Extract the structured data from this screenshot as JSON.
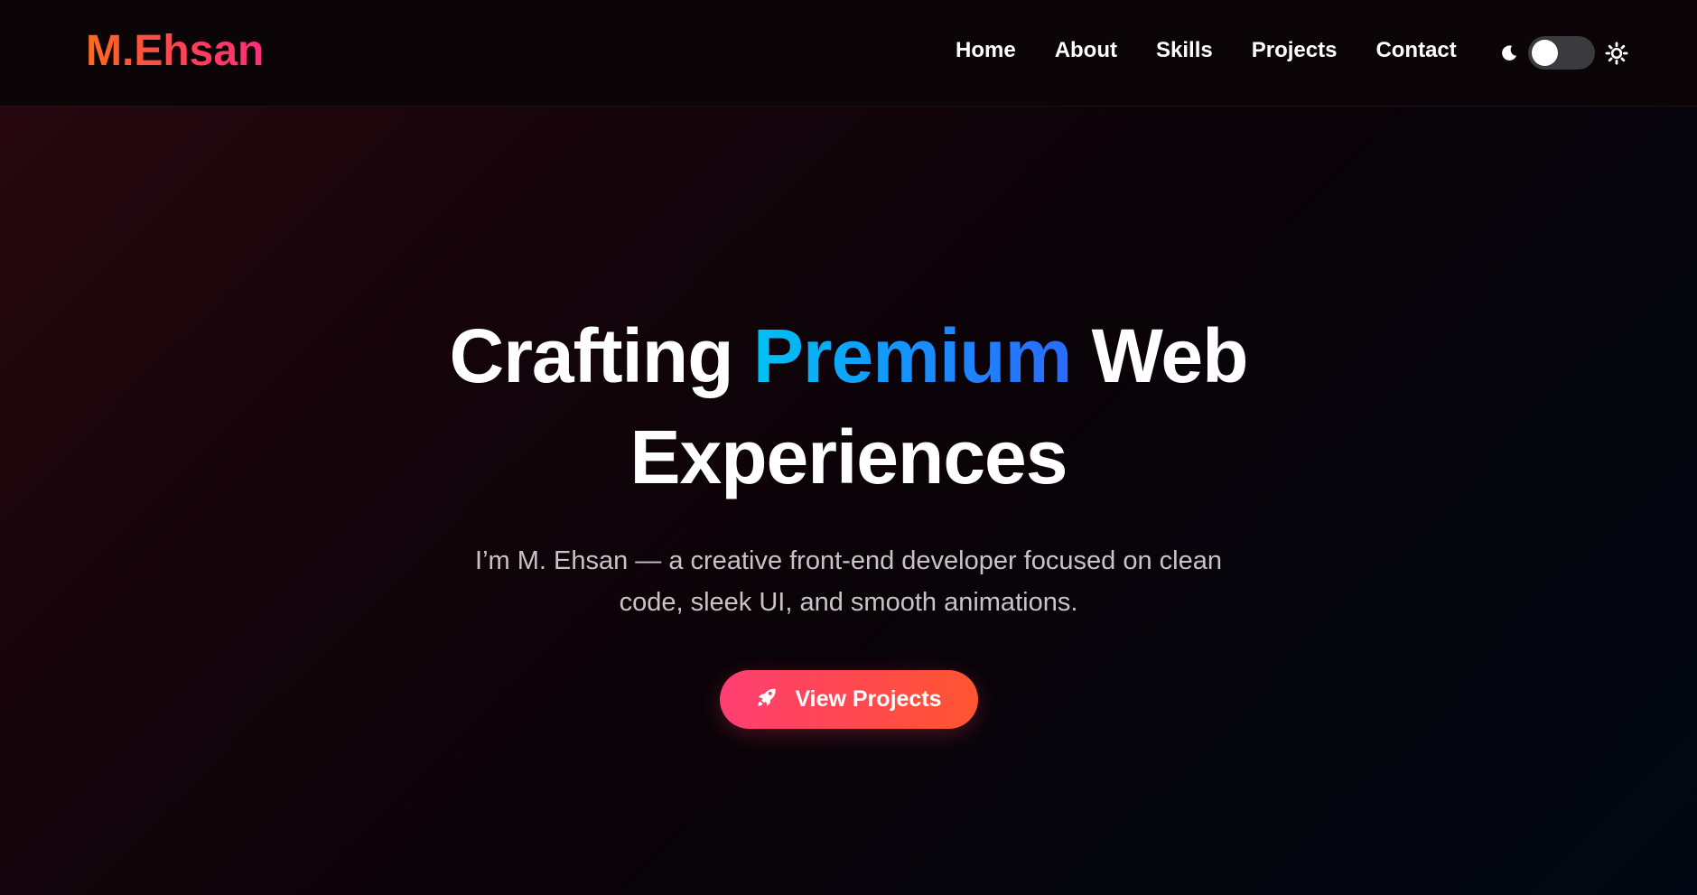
{
  "header": {
    "logo": "M.Ehsan",
    "nav": [
      {
        "label": "Home"
      },
      {
        "label": "About"
      },
      {
        "label": "Skills"
      },
      {
        "label": "Projects"
      },
      {
        "label": "Contact"
      }
    ],
    "theme_toggle": {
      "left_icon": "moon-icon",
      "right_icon": "sun-icon",
      "state": "dark"
    }
  },
  "hero": {
    "title_part1": "Crafting ",
    "title_accent": "Premium",
    "title_part2": " Web",
    "title_line2": "Experiences",
    "subtitle": "I’m M. Ehsan — a creative front-end developer focused on clean code, sleek UI, and smooth animations.",
    "cta_label": "View Projects",
    "cta_icon": "rocket-icon"
  },
  "colors": {
    "logo_gradient": [
      "#ff6a1a",
      "#ff2f7a"
    ],
    "accent_gradient": [
      "#00c2f2",
      "#2a6bff"
    ],
    "cta_gradient": [
      "#ff3f72",
      "#ff5530"
    ]
  }
}
